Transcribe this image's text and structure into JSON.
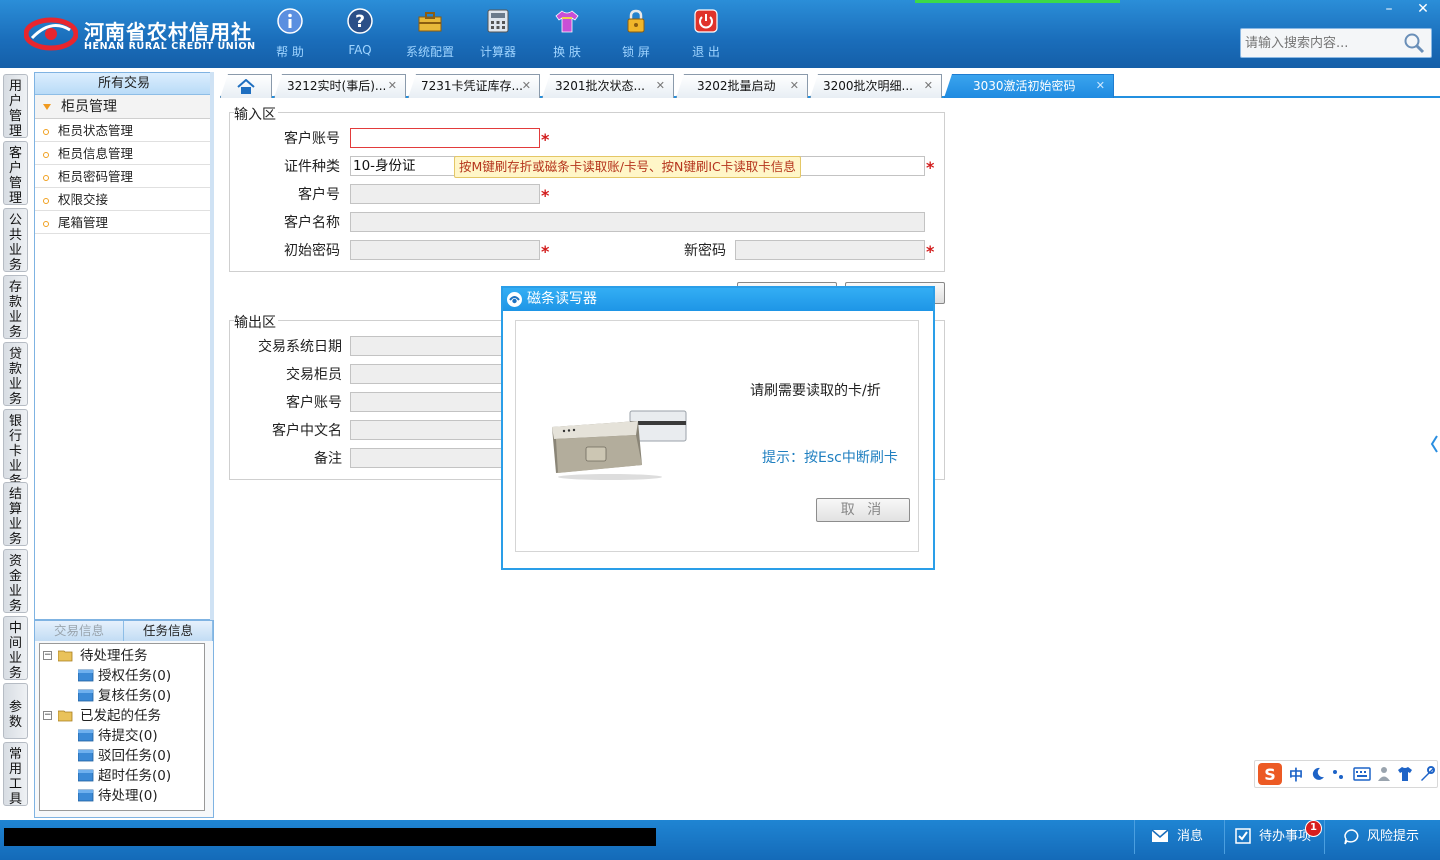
{
  "header": {
    "logo_cn": "河南省农村信用社",
    "logo_en": "HENAN RURAL CREDIT UNION",
    "toolbar": [
      {
        "label": "帮 助",
        "icon": "info-icon"
      },
      {
        "label": "FAQ",
        "icon": "help-icon"
      },
      {
        "label": "系统配置",
        "icon": "toolbox-icon"
      },
      {
        "label": "计算器",
        "icon": "calculator-icon"
      },
      {
        "label": "换 肤",
        "icon": "shirt-icon"
      },
      {
        "label": "锁 屏",
        "icon": "lock-icon"
      },
      {
        "label": "退 出",
        "icon": "power-icon"
      }
    ],
    "search_placeholder": "请输入搜索内容...",
    "window_controls": {
      "minimize": "–",
      "close": "✕"
    }
  },
  "left_tabs": [
    "用户管理",
    "客户管理",
    "公共业务",
    "存款业务",
    "贷款业务",
    "银行卡业务",
    "结算业务",
    "资金业务",
    "中间业务",
    "参数",
    "常用工具"
  ],
  "sidebar": {
    "title": "所有交易",
    "group": "柜员管理",
    "items": [
      "柜员状态管理",
      "柜员信息管理",
      "柜员密码管理",
      "权限交接",
      "尾箱管理"
    ]
  },
  "task_panel": {
    "tabs": [
      "交易信息",
      "任务信息"
    ],
    "tree": {
      "pending": "待处理任务",
      "pending_children": [
        "授权任务(0)",
        "复核任务(0)"
      ],
      "initiated": "已发起的任务",
      "initiated_children": [
        "待提交(0)",
        "驳回任务(0)",
        "超时任务(0)",
        "待处理(0)"
      ]
    }
  },
  "tabs": [
    {
      "label": "3212实时(事后)..."
    },
    {
      "label": "7231卡凭证库存..."
    },
    {
      "label": "3201批次状态..."
    },
    {
      "label": "3202批量启动"
    },
    {
      "label": "3200批次明细..."
    },
    {
      "label": "3030激活初始密码",
      "active": true
    }
  ],
  "form": {
    "input_legend": "输入区",
    "output_legend": "输出区",
    "labels": {
      "account": "客户账号",
      "id_type": "证件种类",
      "customer_no": "客户号",
      "customer_name": "客户名称",
      "initial_pwd": "初始密码",
      "new_pwd": "新密码"
    },
    "id_type_value": "10-身份证",
    "required_mark": "*",
    "tooltip": "按M键刷存折或磁条卡读取账/卡号、按N键刷IC卡读取卡信息",
    "output_labels": [
      "交易系统日期",
      "交易柜员",
      "客户账号",
      "客户中文名",
      "备注"
    ]
  },
  "dialog": {
    "title": "磁条读写器",
    "message": "请刷需要读取的卡/折",
    "hint": "提示：按Esc中断刷卡",
    "cancel": "取 消"
  },
  "ime": {
    "lang": "中"
  },
  "statusbar": {
    "messages": "消息",
    "todo": "待办事项",
    "todo_count": "1",
    "risk": "风险提示"
  },
  "colors": {
    "accent": "#1f8ae0",
    "required": "#d21b1b",
    "tooltip_bg": "#fff6c8"
  }
}
